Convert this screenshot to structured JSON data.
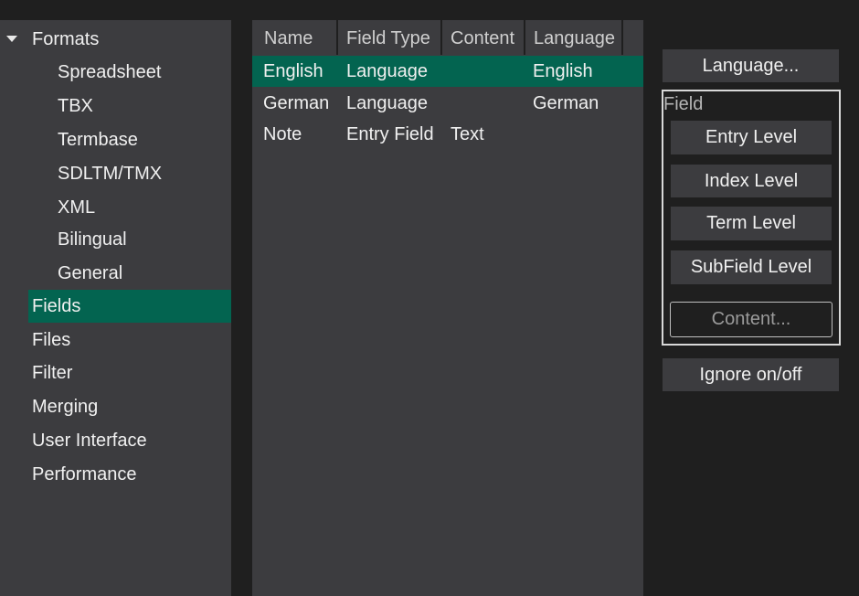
{
  "sidebar": {
    "group_label": "Formats",
    "children": [
      "Spreadsheet",
      "TBX",
      "Termbase",
      "SDLTM/TMX",
      "XML",
      "Bilingual",
      "General"
    ],
    "top_items": [
      "Fields",
      "Files",
      "Filter",
      "Merging",
      "User Interface",
      "Performance"
    ],
    "selected": "Fields"
  },
  "grid": {
    "columns": [
      "Name",
      "Field Type",
      "Content",
      "Language"
    ],
    "rows": [
      {
        "name": "English",
        "field_type": "Language",
        "content": "",
        "language": "English"
      },
      {
        "name": "German",
        "field_type": "Language",
        "content": "",
        "language": "German"
      },
      {
        "name": "Note",
        "field_type": "Entry Field",
        "content": "Text",
        "language": ""
      }
    ]
  },
  "buttons": {
    "language": "Language...",
    "field_group_label": "Field",
    "entry_level": "Entry Level",
    "index_level": "Index Level",
    "term_level": "Term Level",
    "subfield_level": "SubField Level",
    "content": "Content...",
    "ignore": "Ignore on/off"
  },
  "colors": {
    "accent": "#036450",
    "panel": "#3c3c3f",
    "background": "#1f1f1f"
  }
}
